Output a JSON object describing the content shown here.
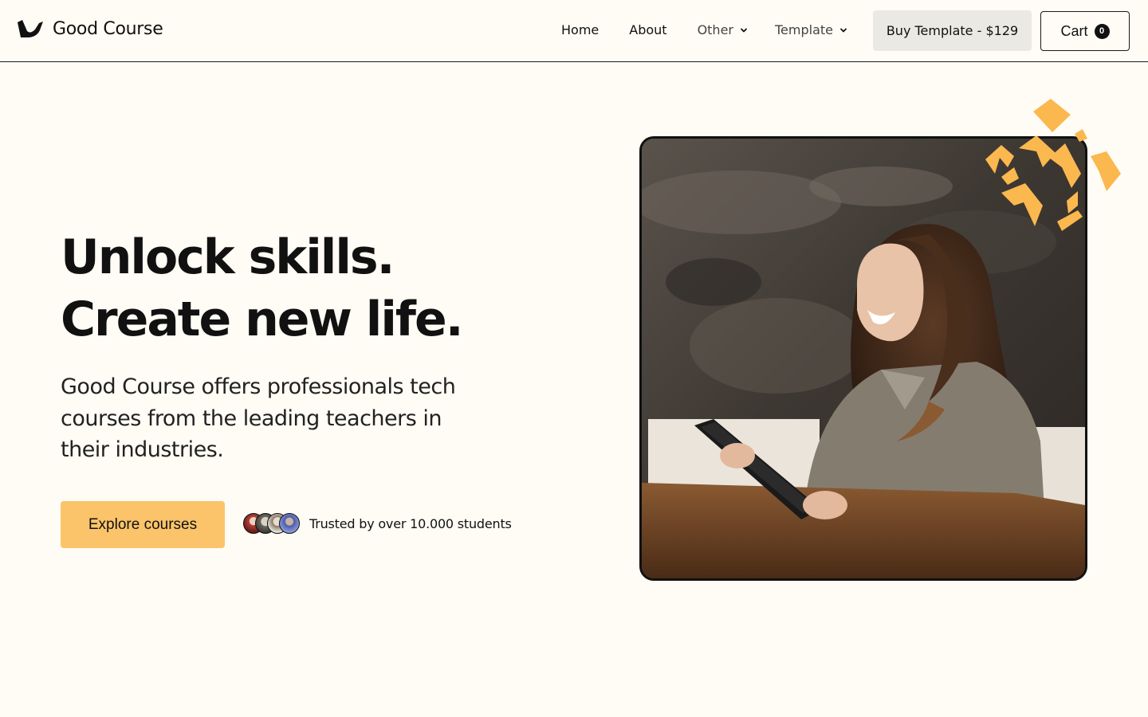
{
  "header": {
    "brand_name": "Good Course",
    "brand_icon": "bird-logo-icon",
    "nav": {
      "home": "Home",
      "about": "About",
      "other": "Other",
      "template": "Template"
    },
    "buy_button": "Buy Template - $129",
    "cart": {
      "label": "Cart",
      "count": "0"
    }
  },
  "hero": {
    "title_line1": "Unlock skills.",
    "title_line2": "Create new life.",
    "description": "Good Course offers professionals tech courses from the leading teachers in their industries.",
    "cta": "Explore courses",
    "trust_text": "Trusted by over 10.000 students"
  },
  "colors": {
    "background": "#fefcf4",
    "accent": "#fbc46a",
    "text": "#111111",
    "buy_button_bg": "#ebe9e3"
  }
}
